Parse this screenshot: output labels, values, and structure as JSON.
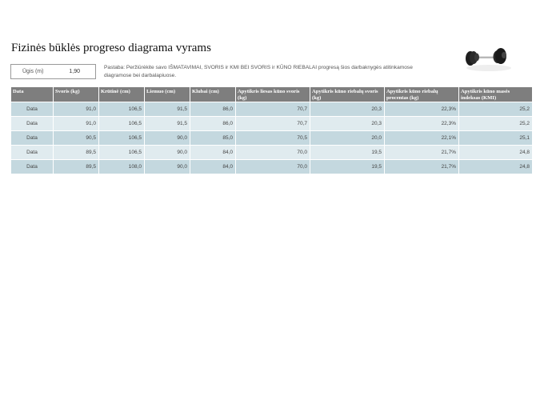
{
  "title": "Fizinės būklės progreso diagrama vyrams",
  "height_field": {
    "label": "Ūgis (m)",
    "value": "1,90"
  },
  "note": "Pastaba: Peržiūrėkite savo IŠMATAVIMAI, SVORIS ir KMI BEI SVORIS ir KŪNO RIEBALAI progresą šios darbaknygės atitinkamose diagramose bei darbalapiuose.",
  "image_icon": "dumbbell-icon",
  "table": {
    "headers": [
      "Data",
      "Svoris (kg)",
      "Krūtinė (cm)",
      "Liemuo (cm)",
      "Klubai (cm)",
      "Apytikris liesas kūno svoris (kg)",
      "Apytikris kūno riebalų svoris (kg)",
      "Apytikris kūno riebalų procentas (kg)",
      "Apytikris kūno masės indeksas (KMI)"
    ],
    "rows": [
      [
        "Data",
        "91,0",
        "106,5",
        "91,5",
        "86,0",
        "70,7",
        "20,3",
        "22,3%",
        "25,2"
      ],
      [
        "Data",
        "91,0",
        "106,5",
        "91,5",
        "86,0",
        "70,7",
        "20,3",
        "22,3%",
        "25,2"
      ],
      [
        "Data",
        "90,5",
        "106,5",
        "90,0",
        "85,0",
        "70,5",
        "20,0",
        "22,1%",
        "25,1"
      ],
      [
        "Data",
        "89,5",
        "106,5",
        "90,0",
        "84,0",
        "70,0",
        "19,5",
        "21,7%",
        "24,8"
      ],
      [
        "Data",
        "89,5",
        "108,0",
        "90,0",
        "84,0",
        "70,0",
        "19,5",
        "21,7%",
        "24,8"
      ]
    ]
  },
  "colors": {
    "header_bg": "#7e7e7e",
    "row_dark": "#c4d8df",
    "row_light": "#e0ebef"
  }
}
